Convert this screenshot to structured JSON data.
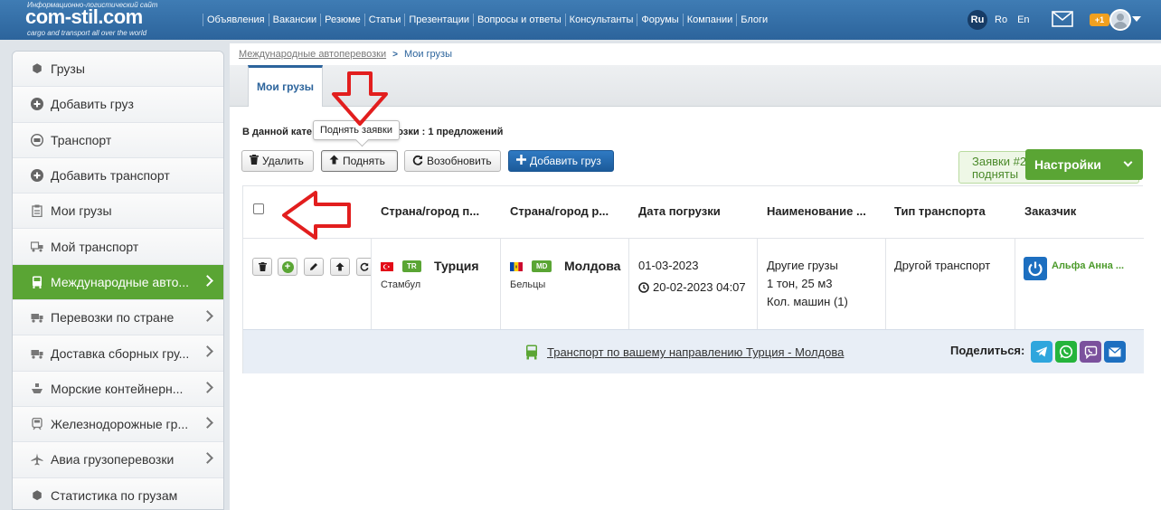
{
  "site": {
    "tagline": "Информационно-логистический сайт",
    "name": "com-stil.com",
    "subtitle": "cargo and transport all over the world"
  },
  "topnav": [
    "Объявления",
    "Вакансии",
    "Резюме",
    "Статьи",
    "Презентации",
    "Вопросы и ответы",
    "Консультанты",
    "Форумы",
    "Компании",
    "Блоги"
  ],
  "languages": {
    "active": "Ru",
    "others": [
      "Ro",
      "En"
    ]
  },
  "header": {
    "notification_badge": "+1"
  },
  "sidebar": {
    "items": [
      {
        "label": "Грузы",
        "icon": "cube-icon"
      },
      {
        "label": "Добавить груз",
        "icon": "plus-circle-icon"
      },
      {
        "label": "Транспорт",
        "icon": "truck-circle-icon"
      },
      {
        "label": "Добавить транспорт",
        "icon": "plus-circle-icon"
      },
      {
        "label": "Мои грузы",
        "icon": "clipboard-icon"
      },
      {
        "label": "Мой транспорт",
        "icon": "trucks-icon"
      },
      {
        "label": "Международные авто...",
        "icon": "bus-icon",
        "active": true
      },
      {
        "label": "Перевозки по стране",
        "icon": "truck-icon"
      },
      {
        "label": "Доставка сборных гру...",
        "icon": "truck-icon"
      },
      {
        "label": "Морские контейнерн...",
        "icon": "ship-icon"
      },
      {
        "label": "Железнодорожные гр...",
        "icon": "train-icon"
      },
      {
        "label": "Авиа грузоперевозки",
        "icon": "plane-icon"
      },
      {
        "label": "Статистика по грузам",
        "icon": "cube-icon"
      }
    ]
  },
  "breadcrumb": {
    "parent": "Международные автоперевозки",
    "separator": ">",
    "current": "Мои грузы"
  },
  "tabs": [
    {
      "label": "Мои грузы"
    }
  ],
  "info_line": "В данной кате",
  "info_line_suffix": "перевозки : 1 предложений",
  "tooltip": "Поднять заявки",
  "toolbar": {
    "delete": "Удалить",
    "raise": "Поднять",
    "renew": "Возобновить",
    "add_cargo": "Добавить груз"
  },
  "requests_box": {
    "line1": "Заявки #2",
    "line2": "подняты"
  },
  "settings_button": "Настройки",
  "table": {
    "columns": [
      "Страна/город п...",
      "Страна/город р...",
      "Дата погрузки",
      "Наименование ...",
      "Тип транспорта",
      "Заказчик"
    ],
    "row": {
      "from": {
        "code": "TR",
        "country": "Турция",
        "city": "Стамбул"
      },
      "to": {
        "code": "MD",
        "country": "Молдова",
        "city": "Бельцы"
      },
      "load_date": "01-03-2023",
      "posted": "20-02-2023 04:07",
      "cargo": [
        "Другие грузы",
        "1 тон, 25 м3",
        "Кол. машин (1)"
      ],
      "transport_type": "Другой транспорт",
      "customer": "Альфа Анна ..."
    },
    "footer_link": "Транспорт по вашему направлению Турция - Молдова",
    "share_label": "Поделиться:"
  },
  "colors": {
    "header": "#2c649c",
    "accent_green": "#5aa534",
    "arrow_red": "#e21e1e"
  }
}
